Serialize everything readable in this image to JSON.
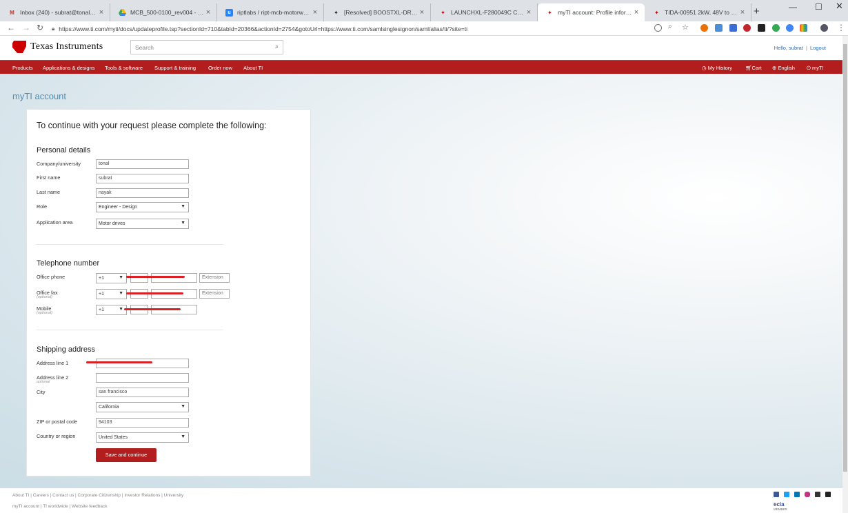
{
  "browser": {
    "tabs": [
      {
        "title": "Inbox (240) - subrat@tonal.com",
        "icon": "gmail-icon",
        "active": false
      },
      {
        "title": "MCB_500-0100_rev004 - Google",
        "icon": "drive-icon",
        "active": false
      },
      {
        "title": "riptlabs / ript-mcb-motorware / i",
        "icon": "bitbucket-icon",
        "active": false
      },
      {
        "title": "[Resolved] BOOSTXL-DRV8320R",
        "icon": "ti-icon",
        "active": false
      },
      {
        "title": "LAUNCHXL-F280049C C2000 Pic",
        "icon": "ti-icon",
        "active": false
      },
      {
        "title": "myTI account: Profile informatio",
        "icon": "ti-icon",
        "active": true
      },
      {
        "title": "TIDA-00951 2kW, 48V to 400V, >",
        "icon": "ti-icon",
        "active": false
      }
    ],
    "url": "https://www.ti.com/myti/docs/updateprofile.tsp?sectionId=710&tabId=20366&actionId=2754&gotoUrl=https://www.ti.com/samlsinglesignon/saml/alias/ti/?site=ti"
  },
  "header": {
    "logo_text": "Texas Instruments",
    "search_placeholder": "Search",
    "hello": "Hello, subrat",
    "sep": "|",
    "logout": "Logout"
  },
  "nav": {
    "items": [
      "Products",
      "Applications & designs",
      "Tools & software",
      "Support & training",
      "Order now",
      "About TI"
    ],
    "right": [
      "My History",
      "Cart",
      "English",
      "myTI"
    ]
  },
  "page": {
    "title": "myTI account",
    "intro": "To continue with your request please complete the following:"
  },
  "personal": {
    "heading": "Personal details",
    "company_label": "Company/university",
    "company": "tonal",
    "first_label": "First name",
    "first": "subrat",
    "last_label": "Last name",
    "last": "nayak",
    "role_label": "Role",
    "role": "Engineer - Design",
    "app_label": "Application area",
    "app": "Motor drives"
  },
  "telephone": {
    "heading": "Telephone number",
    "office_label": "Office phone",
    "fax_label": "Office fax",
    "mobile_label": "Mobile",
    "optional": "(optional)",
    "country_code": "+1",
    "extension": "Extension"
  },
  "shipping": {
    "heading": "Shipping address",
    "addr1_label": "Address line 1",
    "addr2_label": "Address line 2",
    "addr2_hint": "optional",
    "city_label": "City",
    "city": "san francisco",
    "state": "California",
    "zip_label": "ZIP or postal code",
    "zip": "94103",
    "country_label": "Country or region",
    "country": "United States"
  },
  "save_label": "Save and continue",
  "footer": {
    "line1": "About TI | Careers | Contact us | Corporate Citizenship | Investor Relations | University",
    "line2": "myTI account | TI worldwide | Website feedback",
    "ecia": "ecia",
    "member": "MEMBER"
  },
  "colors": {
    "ti_red": "#b21d1d",
    "link_blue": "#2a6ab0",
    "redaction": "#d92024"
  }
}
